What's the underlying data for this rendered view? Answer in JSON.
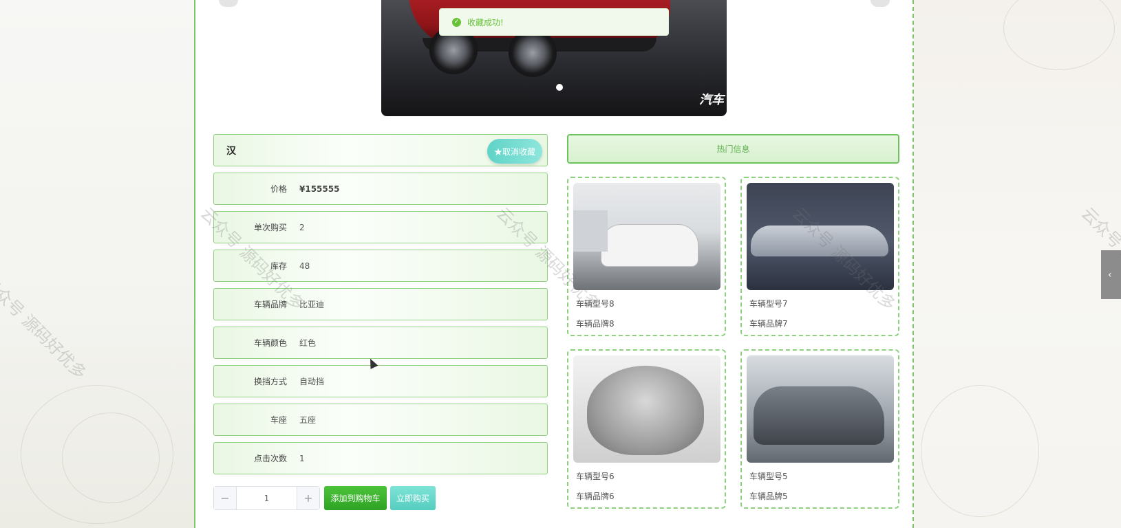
{
  "toast": {
    "message": "收藏成功!",
    "icon": "check-circle-icon"
  },
  "carousel": {
    "watermark_text": "汽车"
  },
  "product": {
    "name": "汉",
    "favorite_button": "★取消收藏",
    "fields": [
      {
        "label": "价格",
        "value": "¥155555"
      },
      {
        "label": "单次购买",
        "value": "2"
      },
      {
        "label": "库存",
        "value": "48"
      },
      {
        "label": "车辆品牌",
        "value": "比亚迪"
      },
      {
        "label": "车辆颜色",
        "value": "红色"
      },
      {
        "label": "换挡方式",
        "value": "自动挡"
      },
      {
        "label": "车座",
        "value": "五座"
      },
      {
        "label": "点击次数",
        "value": "1"
      }
    ]
  },
  "purchase": {
    "quantity": "1",
    "minus": "−",
    "plus": "+",
    "add_to_cart": "添加到购物车",
    "buy_now": "立即购买"
  },
  "hot": {
    "title": "热门信息",
    "items": [
      {
        "model": "车辆型号8",
        "brand": "车辆品牌8"
      },
      {
        "model": "车辆型号7",
        "brand": "车辆品牌7"
      },
      {
        "model": "车辆型号6",
        "brand": "车辆品牌6"
      },
      {
        "model": "车辆型号5",
        "brand": "车辆品牌5"
      }
    ]
  },
  "side_tab": {
    "icon": "chevron-left-icon",
    "glyph": "‹"
  },
  "watermark": {
    "text": "云众号 源码好优多"
  },
  "colors": {
    "accent_green": "#7cc56a",
    "button_teal": "#5fd3c7",
    "cart_green": "#2ea324",
    "toast_green": "#67c23a"
  }
}
